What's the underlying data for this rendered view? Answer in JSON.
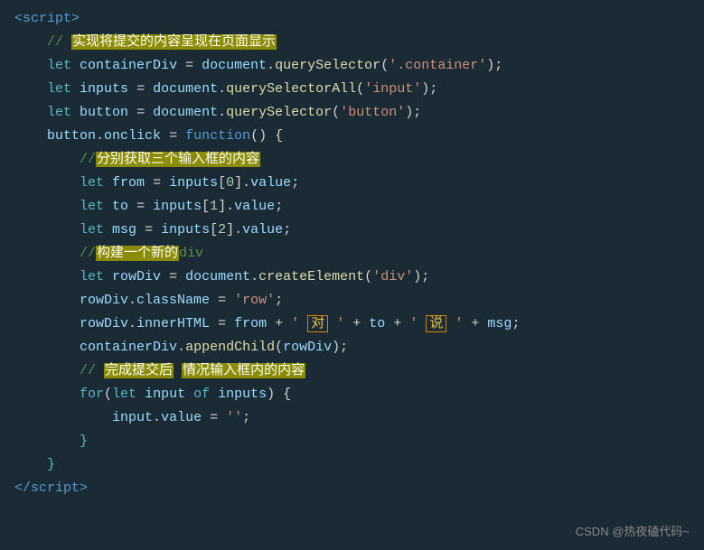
{
  "code": {
    "lines": [
      {
        "id": "line1",
        "content": "script_open"
      },
      {
        "id": "line2",
        "content": "comment1"
      },
      {
        "id": "line3",
        "content": "let_container"
      },
      {
        "id": "line4",
        "content": "let_inputs"
      },
      {
        "id": "line5",
        "content": "let_button"
      },
      {
        "id": "line6",
        "content": "button_onclick"
      },
      {
        "id": "line7",
        "content": "comment2"
      },
      {
        "id": "line8",
        "content": "let_from"
      },
      {
        "id": "line9",
        "content": "let_to"
      },
      {
        "id": "line10",
        "content": "let_msg"
      },
      {
        "id": "line11",
        "content": "comment3"
      },
      {
        "id": "line12",
        "content": "let_rowdiv"
      },
      {
        "id": "line13",
        "content": "rowdiv_classname"
      },
      {
        "id": "line14",
        "content": "rowdiv_innerhtml"
      },
      {
        "id": "line15",
        "content": "container_appendchild"
      },
      {
        "id": "line16",
        "content": "comment4"
      },
      {
        "id": "line17",
        "content": "for_loop"
      },
      {
        "id": "line18",
        "content": "input_value"
      },
      {
        "id": "line19",
        "content": "close_brace_inner"
      },
      {
        "id": "line20",
        "content": "close_brace_outer"
      },
      {
        "id": "line21",
        "content": "script_close"
      }
    ]
  },
  "watermark": "CSDN @热夜磕代码~"
}
